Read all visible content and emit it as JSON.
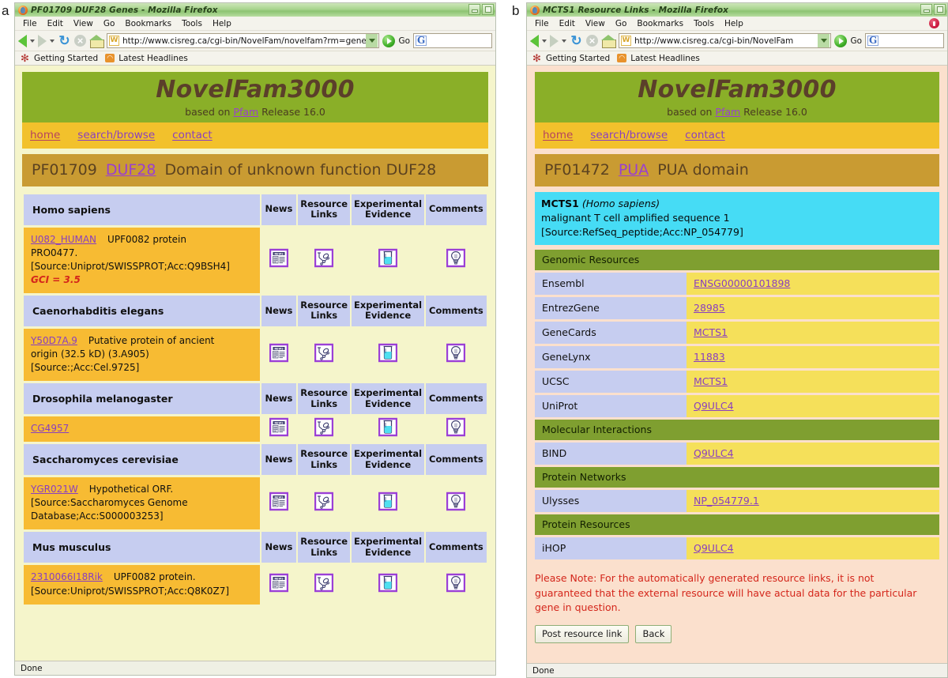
{
  "panels": {
    "a": "a",
    "b": "b"
  },
  "left_window": {
    "title": "PF01709 DUF28 Genes - Mozilla Firefox",
    "menu": [
      "File",
      "Edit",
      "View",
      "Go",
      "Bookmarks",
      "Tools",
      "Help"
    ],
    "url": "http://www.cisreg.ca/cgi-bin/NovelFam/novelfam?rm=gene",
    "go_label": "Go",
    "bookmarks": [
      "Getting Started",
      "Latest Headlines"
    ],
    "status": "Done"
  },
  "right_window": {
    "title": "MCTS1 Resource Links - Mozilla Firefox",
    "menu": [
      "File",
      "Edit",
      "View",
      "Go",
      "Bookmarks",
      "Tools",
      "Help"
    ],
    "url": "http://www.cisreg.ca/cgi-bin/NovelFam",
    "go_label": "Go",
    "bookmarks": [
      "Getting Started",
      "Latest Headlines"
    ],
    "status": "Done"
  },
  "site": {
    "title": "NovelFam3000",
    "subtitle_pre": "based on ",
    "subtitle_link": "Pfam",
    "subtitle_post": " Release 16.0",
    "nav": [
      "home",
      "search/browse",
      "contact"
    ]
  },
  "left_page": {
    "pfam_id": "PF01709",
    "pfam_acc": "DUF28",
    "pfam_desc": "Domain of unknown function DUF28",
    "columns": [
      "News",
      "Resource Links",
      "Experimental Evidence",
      "Comments"
    ],
    "column_lines": [
      [
        "News"
      ],
      [
        "Resource",
        "Links"
      ],
      [
        "Experimental",
        "Evidence"
      ],
      [
        "Comments"
      ]
    ],
    "icons": [
      "news-icon",
      "resource-links-icon",
      "experimental-evidence-icon",
      "comments-icon"
    ],
    "species": [
      {
        "name": "Homo sapiens",
        "gene_id": "U082_HUMAN",
        "description": "UPF0082 protein PRO0477.",
        "source": "[Source:Uniprot/SWISSPROT;Acc:Q9BSH4]",
        "gci": "GCI = 3.5",
        "lines": [
          "UPF0082 protein",
          "PRO0477.",
          "[Source:Uniprot/SWISSPROT;Acc:Q9BSH4]"
        ]
      },
      {
        "name": "Caenorhabditis elegans",
        "gene_id": "Y50D7A.9",
        "description": "Putative protein of ancient origin (32.5 kD) (3.A905)",
        "source": "[Source:;Acc:Cel.9725]",
        "gci": "",
        "lines": [
          "Putative protein of ancient",
          "origin (32.5 kD) (3.A905)",
          "[Source:;Acc:Cel.9725]"
        ]
      },
      {
        "name": "Drosophila melanogaster",
        "gene_id": "CG4957",
        "description": "",
        "source": "",
        "gci": "",
        "lines": []
      },
      {
        "name": "Saccharomyces cerevisiae",
        "gene_id": "YGR021W",
        "description": "Hypothetical ORF.",
        "source": "[Source:Saccharomyces Genome Database;Acc:S000003253]",
        "gci": "",
        "lines": [
          "Hypothetical ORF.",
          "[Source:Saccharomyces Genome",
          "Database;Acc:S000003253]"
        ]
      },
      {
        "name": "Mus musculus",
        "gene_id": "2310066I18Rik",
        "description": "UPF0082 protein.",
        "source": "[Source:Uniprot/SWISSPROT;Acc:Q8K0Z7]",
        "gci": "",
        "lines": [
          "UPF0082 protein.",
          "[Source:Uniprot/SWISSPROT;Acc:Q8K0Z7]"
        ]
      }
    ]
  },
  "right_page": {
    "pfam_id": "PF01472",
    "pfam_acc": "PUA",
    "pfam_desc": "PUA domain",
    "gene_name": "MCTS1",
    "gene_species": "(Homo sapiens)",
    "gene_description": "malignant T cell amplified sequence 1 [Source:RefSeq_peptide;Acc:NP_054779]",
    "sections": [
      {
        "title": "Genomic Resources",
        "rows": [
          {
            "name": "Ensembl",
            "value": "ENSG00000101898"
          },
          {
            "name": "EntrezGene",
            "value": "28985"
          },
          {
            "name": "GeneCards",
            "value": "MCTS1"
          },
          {
            "name": "GeneLynx",
            "value": "11883"
          },
          {
            "name": "UCSC",
            "value": "MCTS1"
          },
          {
            "name": "UniProt",
            "value": "Q9ULC4"
          }
        ]
      },
      {
        "title": "Molecular Interactions",
        "rows": [
          {
            "name": "BIND",
            "value": "Q9ULC4"
          }
        ]
      },
      {
        "title": "Protein Networks",
        "rows": [
          {
            "name": "Ulysses",
            "value": "NP_054779.1"
          }
        ]
      },
      {
        "title": "Protein Resources",
        "rows": [
          {
            "name": "iHOP",
            "value": "Q9ULC4"
          }
        ]
      }
    ],
    "note": "Please Note: For the automatically generated resource links, it is not guaranteed that the external resource will have actual data for the particular gene in question.",
    "buttons": [
      "Post resource link",
      "Back"
    ]
  },
  "colors": {
    "header_green": "#8aaf28",
    "nav_yellow": "#f2c12c",
    "pfam_bar": "#c99b32",
    "gene_row": "#f7bb33",
    "species_header": "#c6cdf0",
    "page_bg_left": "#f5f5cb",
    "page_bg_right": "#fbe0cd",
    "gene_banner": "#46dcf5",
    "section_green": "#7f9f30",
    "value_yellow": "#f5e05a",
    "link_purple": "#8a3fbf",
    "warning_red": "#d4261b"
  }
}
